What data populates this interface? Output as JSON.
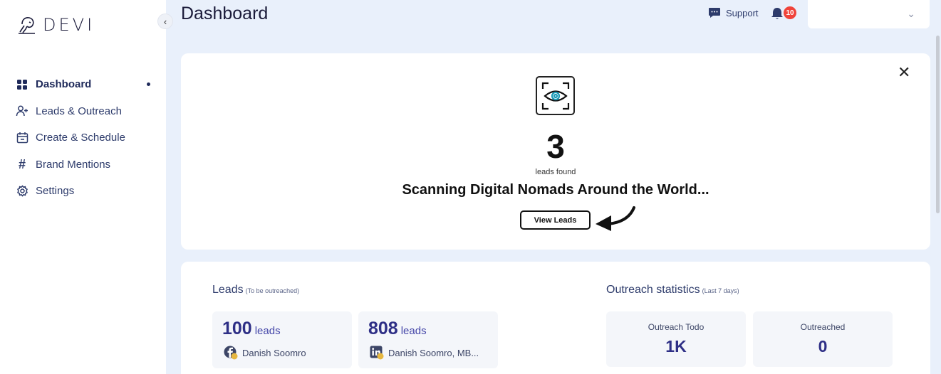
{
  "app": {
    "logo_text": "DEVI"
  },
  "sidebar": {
    "items": [
      {
        "label": "Dashboard",
        "icon": "grid-icon",
        "active": true
      },
      {
        "label": "Leads & Outreach",
        "icon": "user-plus-icon"
      },
      {
        "label": "Create & Schedule",
        "icon": "calendar-icon"
      },
      {
        "label": "Brand Mentions",
        "icon": "hash-icon"
      },
      {
        "label": "Settings",
        "icon": "gear-icon"
      }
    ]
  },
  "header": {
    "title": "Dashboard",
    "support_label": "Support",
    "notification_count": "10"
  },
  "scan": {
    "count": "3",
    "count_label": "leads found",
    "status": "Scanning Digital Nomads Around the World...",
    "view_button": "View Leads"
  },
  "leads": {
    "title": "Leads",
    "subtitle": "(To be outreached)",
    "cards": [
      {
        "count": "100",
        "unit": "leads",
        "account": "Danish Soomro",
        "platform": "facebook-icon"
      },
      {
        "count": "808",
        "unit": "leads",
        "account": "Danish Soomro, MB...",
        "platform": "linkedin-icon"
      }
    ]
  },
  "outreach": {
    "title": "Outreach statistics",
    "subtitle": "(Last 7 days)",
    "stats": [
      {
        "label": "Outreach Todo",
        "value": "1K"
      },
      {
        "label": "Outreached",
        "value": "0"
      }
    ]
  },
  "colors": {
    "accent": "#2e2f86",
    "badge": "#f0433a",
    "background": "#e9f0fb"
  }
}
